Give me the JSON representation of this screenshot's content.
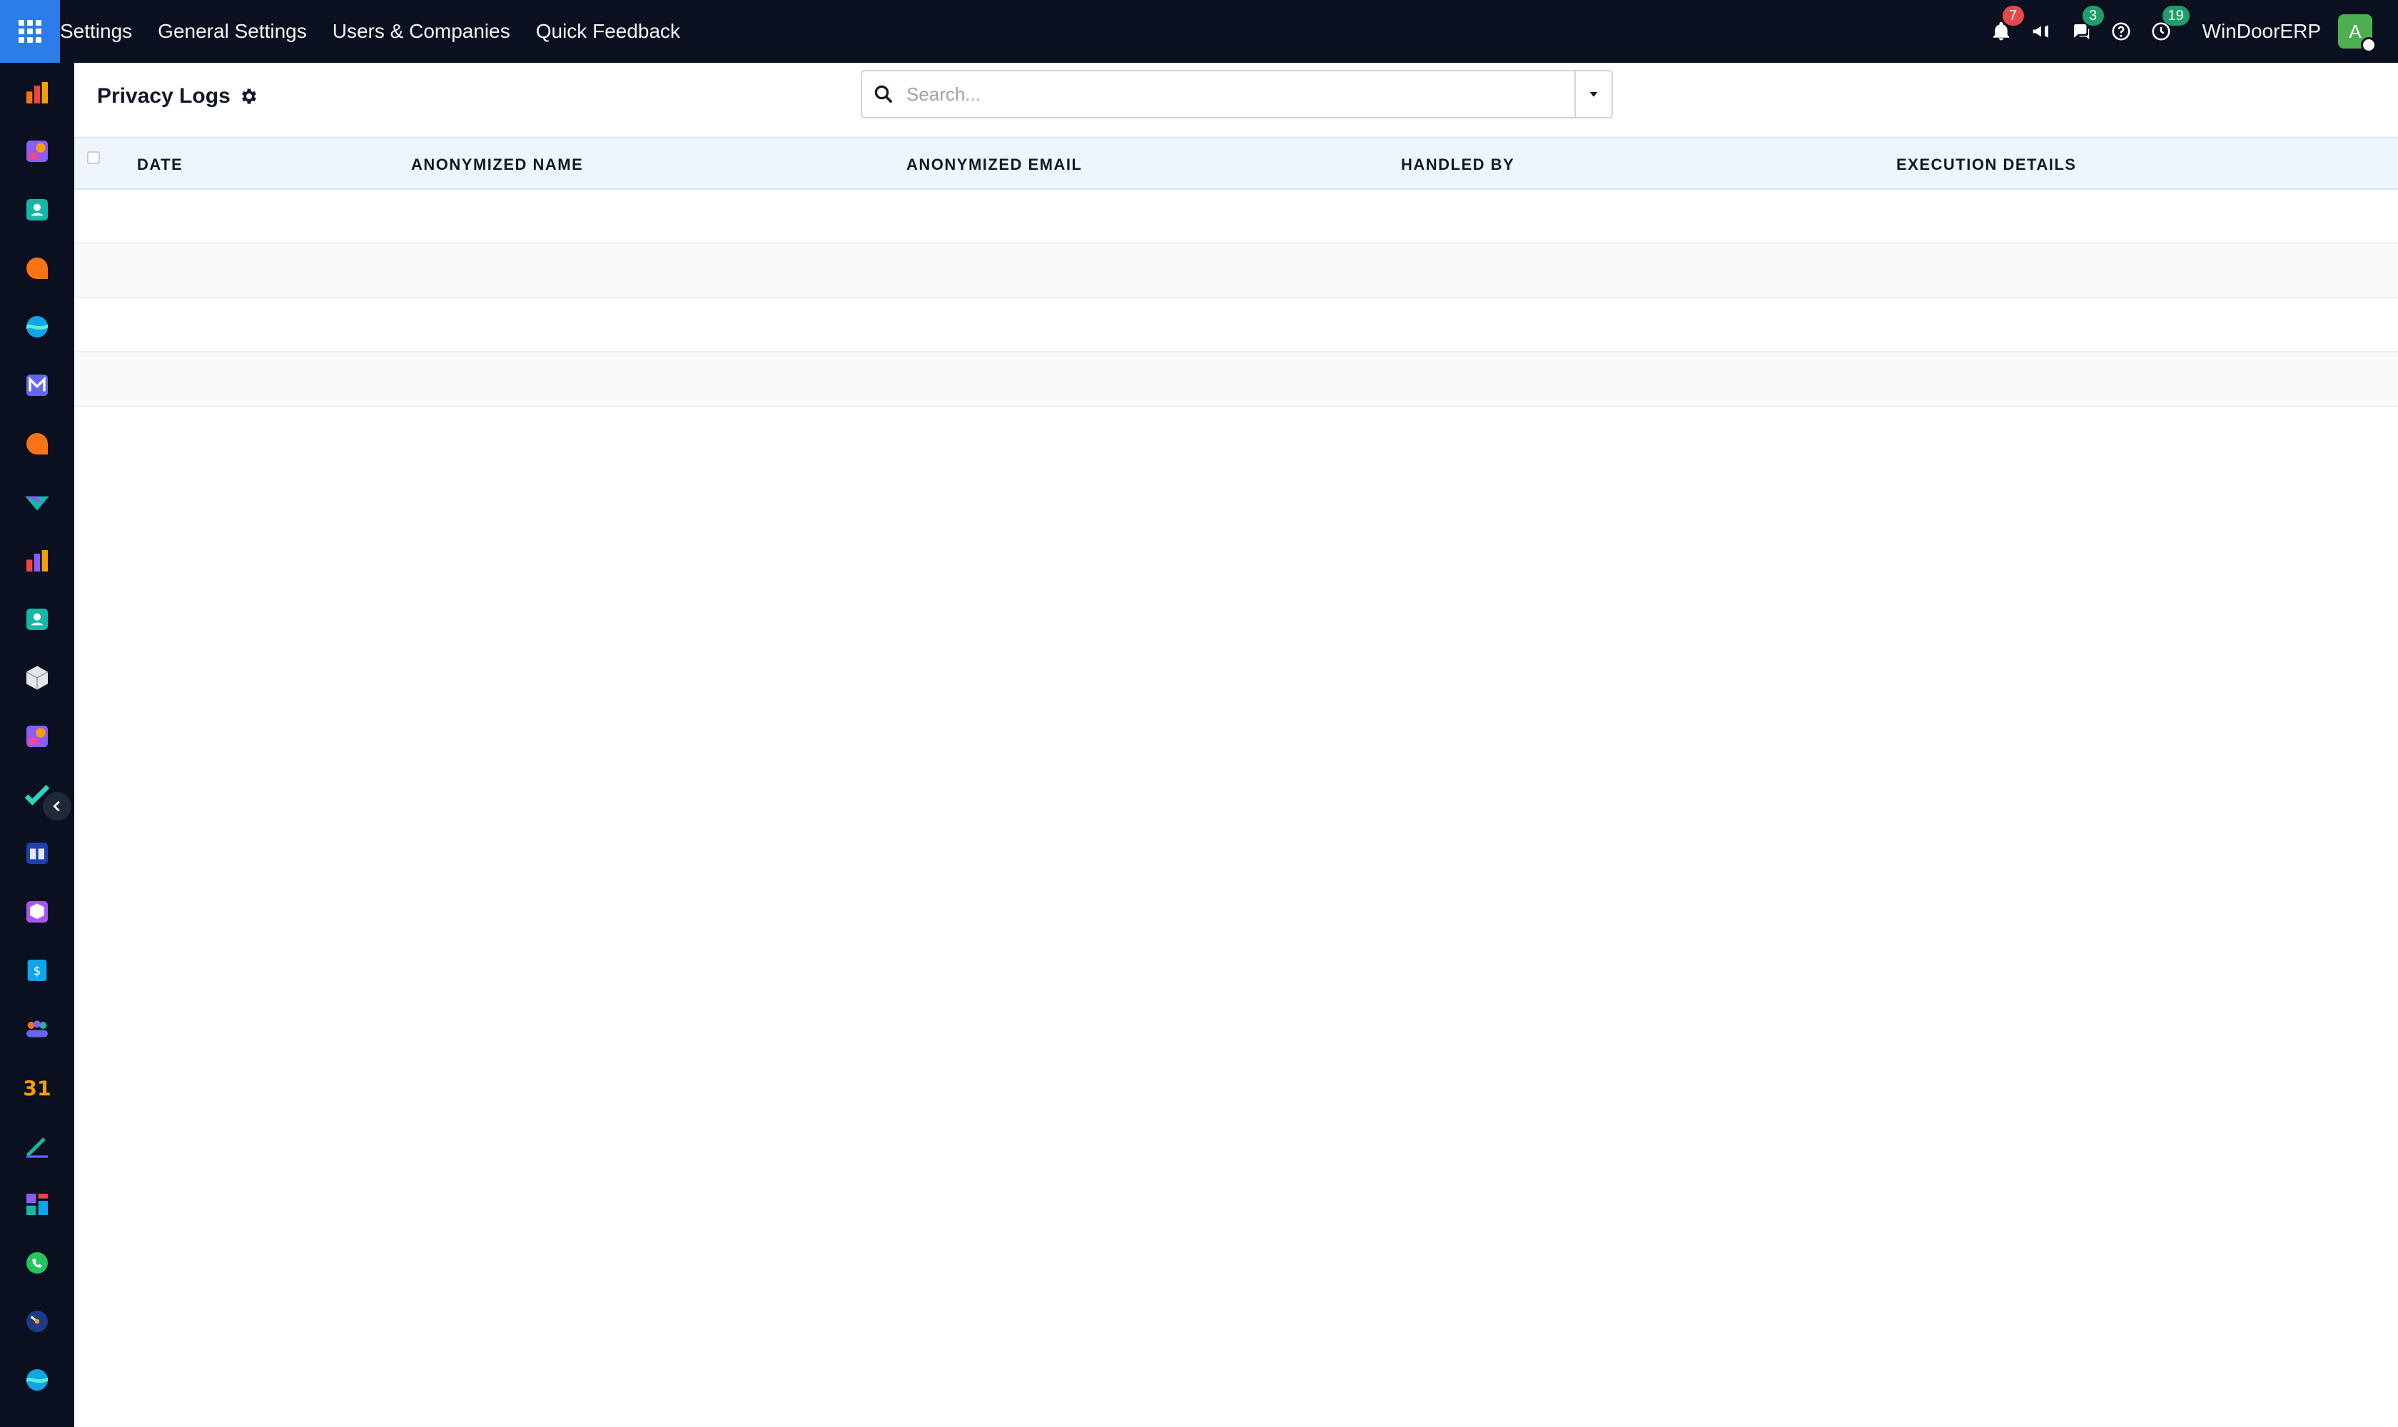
{
  "navbar": {
    "menu": [
      "Settings",
      "General Settings",
      "Users & Companies",
      "Quick Feedback"
    ],
    "notifications_count": "7",
    "messages_count": "3",
    "activities_count": "19",
    "company_name": "WinDoorERP",
    "avatar_letter": "A"
  },
  "control_panel": {
    "title": "Privacy Logs",
    "search_placeholder": "Search..."
  },
  "table": {
    "columns": [
      "DATE",
      "ANONYMIZED NAME",
      "ANONYMIZED EMAIL",
      "HANDLED BY",
      "EXECUTION DETAILS"
    ],
    "rows": []
  },
  "sidebar": {
    "apps": [
      "dashboard-app-icon",
      "crm-app-icon",
      "contacts-app-icon",
      "discuss-app-icon",
      "website-app-icon",
      "mail-app-icon",
      "livechat-app-icon",
      "project-app-icon",
      "reporting-app-icon",
      "employees-app-icon",
      "inventory-app-icon",
      "sales-app-icon",
      "tasks-app-icon",
      "knowledge-app-icon",
      "purchase-app-icon",
      "invoicing-app-icon",
      "team-app-icon",
      "calendar-app-icon",
      "sign-app-icon",
      "apps-app-icon",
      "whatsapp-app-icon",
      "timesheet-app-icon",
      "website-builder-app-icon"
    ]
  },
  "colors": {
    "navbar_bg": "#0b1020",
    "apps_button": "#2b7de9",
    "table_header_bg": "#eef5fd",
    "badge_red": "#e5484d",
    "badge_green": "#1f9d6b",
    "avatar_bg": "#4caf50"
  }
}
